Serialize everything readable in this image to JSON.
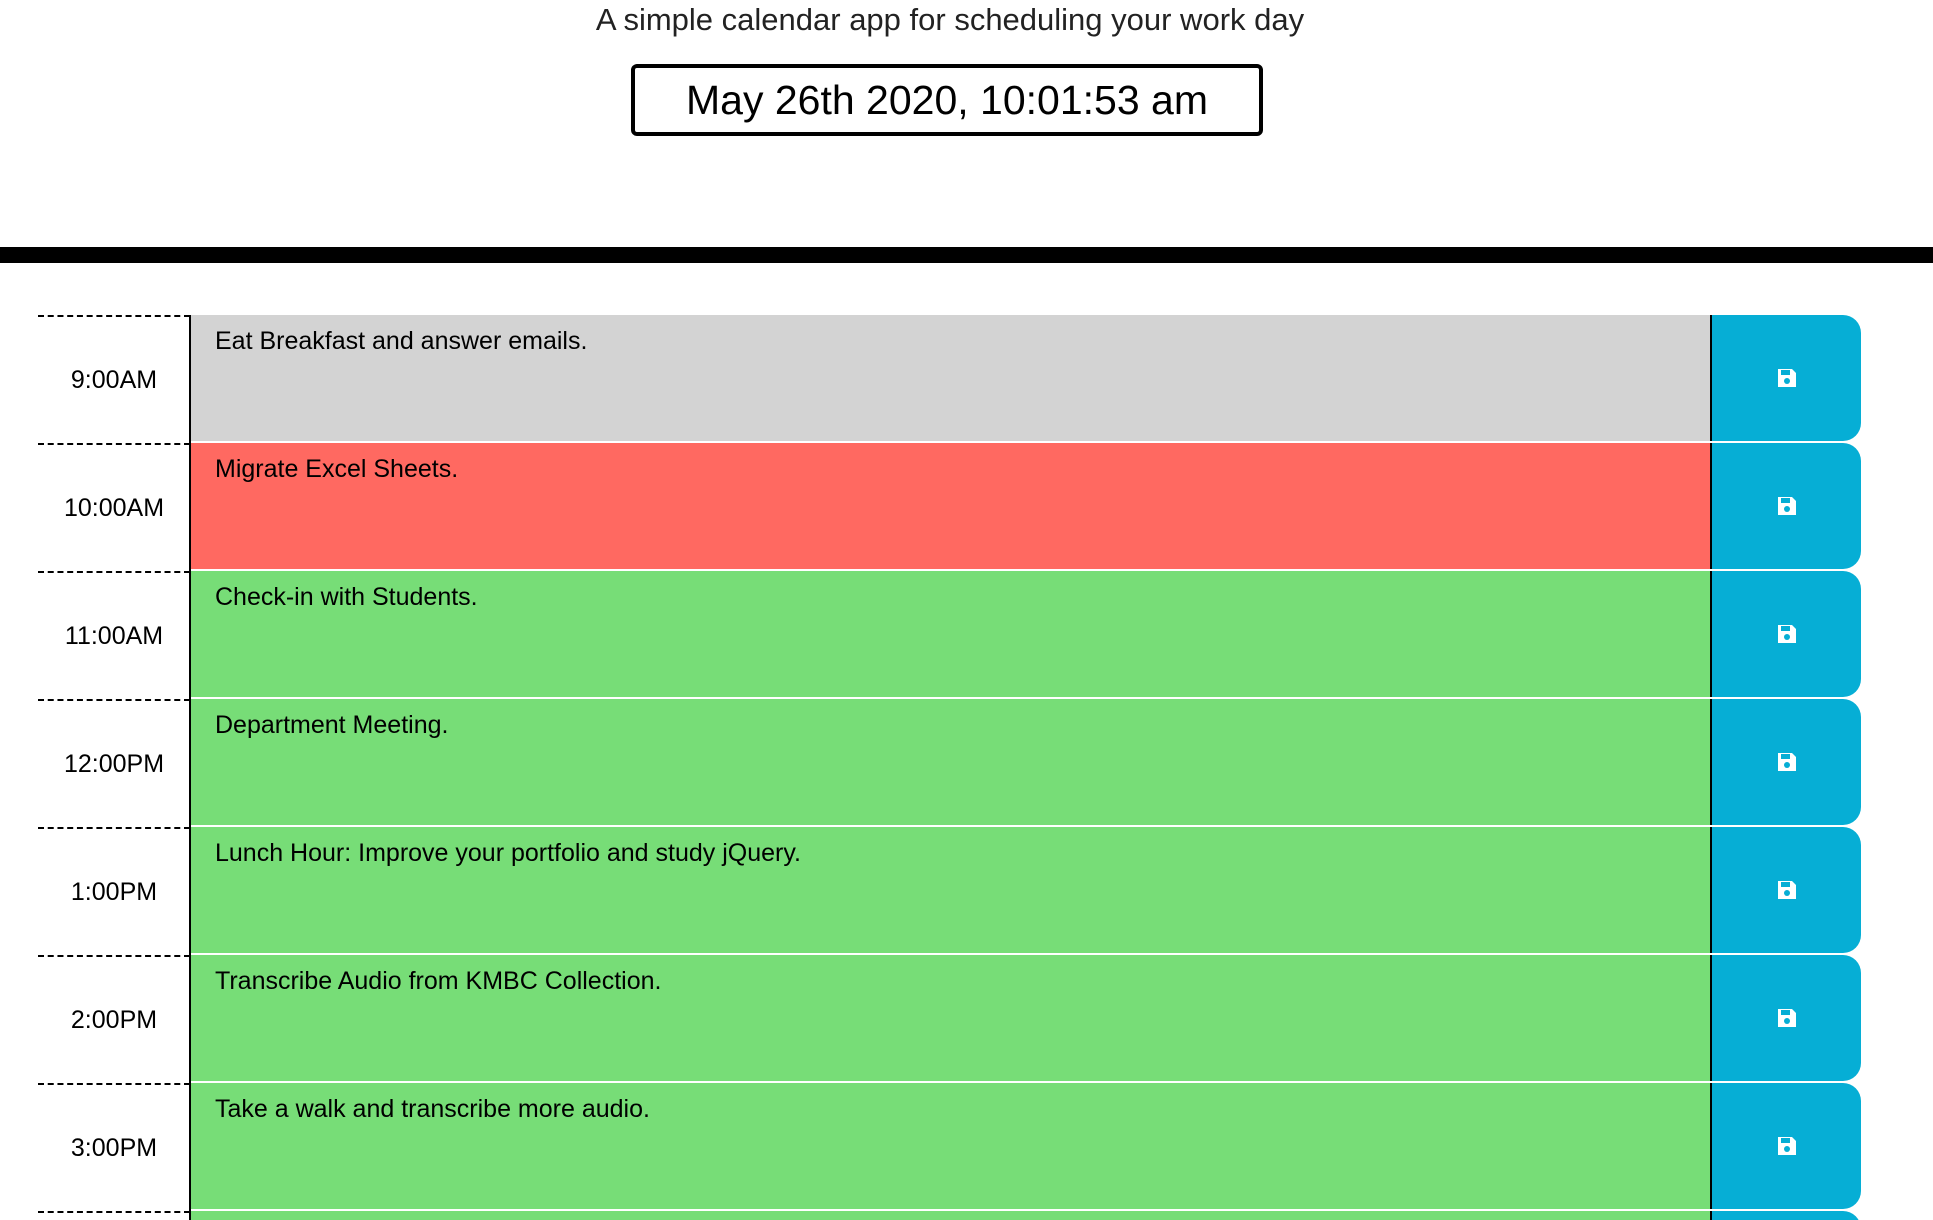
{
  "header": {
    "subtitle": "A simple calendar app for scheduling your work day",
    "current_datetime": "May 26th 2020, 10:01:53 am"
  },
  "colors": {
    "past": "#d3d3d3",
    "present": "#ff6961",
    "future": "#77dd77",
    "save_button": "#06aed5"
  },
  "timeblocks": [
    {
      "hour": "9:00AM",
      "text": "Eat Breakfast and answer emails.",
      "status": "past",
      "save_icon": "floppy-disk-icon"
    },
    {
      "hour": "10:00AM",
      "text": "Migrate Excel Sheets.",
      "status": "present",
      "save_icon": "floppy-disk-icon"
    },
    {
      "hour": "11:00AM",
      "text": "Check-in with Students.",
      "status": "future",
      "save_icon": "floppy-disk-icon"
    },
    {
      "hour": "12:00PM",
      "text": "Department Meeting.",
      "status": "future",
      "save_icon": "floppy-disk-icon"
    },
    {
      "hour": "1:00PM",
      "text": "Lunch Hour: Improve your portfolio and study jQuery.",
      "status": "future",
      "save_icon": "floppy-disk-icon"
    },
    {
      "hour": "2:00PM",
      "text": "Transcribe Audio from KMBC Collection.",
      "status": "future",
      "save_icon": "floppy-disk-icon"
    },
    {
      "hour": "3:00PM",
      "text": "Take a walk and transcribe more audio.",
      "status": "future",
      "save_icon": "floppy-disk-icon"
    }
  ]
}
